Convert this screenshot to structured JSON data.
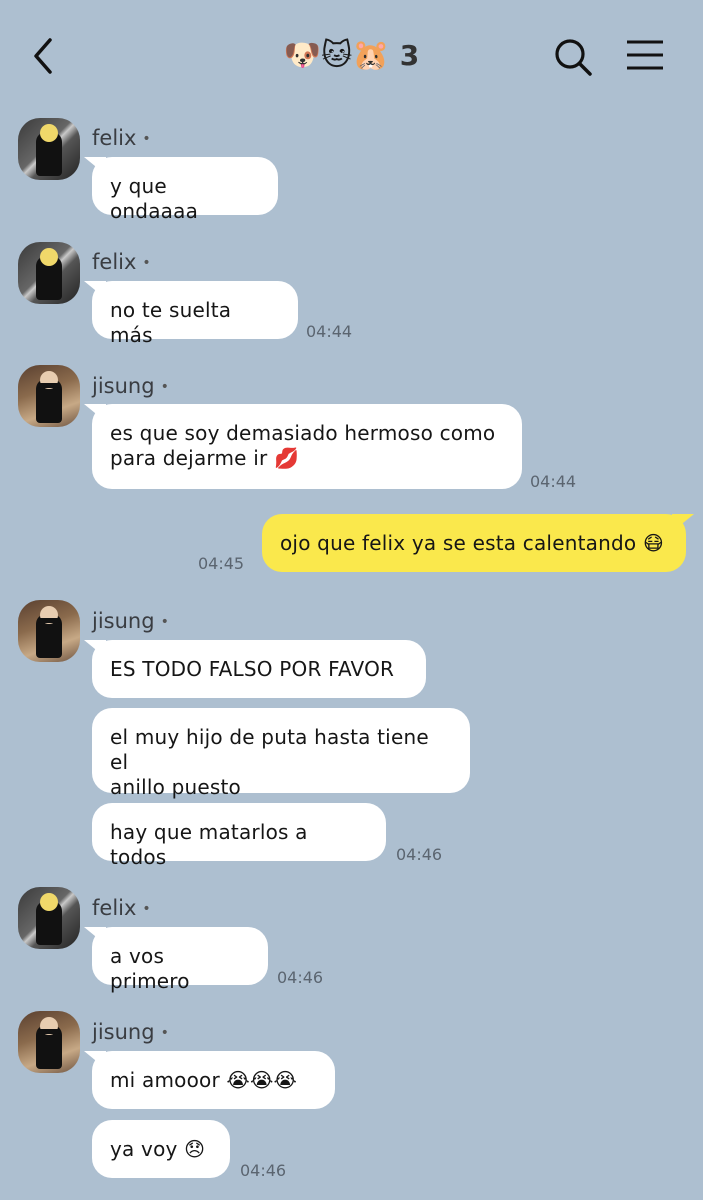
{
  "header": {
    "title_emojis": "🐶🐱🐹",
    "member_count": "3"
  },
  "senders": {
    "felix": "felix",
    "jisung": "jisung",
    "dot": "•"
  },
  "messages": [
    {
      "sender": "felix",
      "text": "y que ondaaaa",
      "time": ""
    },
    {
      "sender": "felix",
      "text": "no te suelta más",
      "time": "04:44"
    },
    {
      "sender": "jisung",
      "text_line1": "es que soy demasiado hermoso como",
      "text_line2": "para dejarme ir 💋",
      "time": "04:44"
    },
    {
      "sender": "me",
      "text": "ojo que felix ya se esta calentando 😷",
      "time": "04:45"
    },
    {
      "sender": "jisung",
      "text": "ES TODO FALSO POR FAVOR",
      "time": ""
    },
    {
      "sender": "jisung",
      "text_line1": "el muy hijo de puta hasta tiene el",
      "text_line2": "anillo puesto",
      "time": ""
    },
    {
      "sender": "jisung",
      "text": "hay que matarlos a todos",
      "time": "04:46"
    },
    {
      "sender": "felix",
      "text": "a vos primero",
      "time": "04:46"
    },
    {
      "sender": "jisung",
      "text": "mi amooor 😭😭😭",
      "time": ""
    },
    {
      "sender": "jisung",
      "text": "ya voy 😞",
      "time": "04:46"
    }
  ],
  "icons": {
    "back": "chevron-left-icon",
    "search": "search-icon",
    "menu": "hamburger-menu-icon"
  },
  "colors": {
    "background": "#adbfd0",
    "incoming_bubble": "#ffffff",
    "outgoing_bubble": "#fae84c",
    "timestamp": "#5b6570"
  }
}
